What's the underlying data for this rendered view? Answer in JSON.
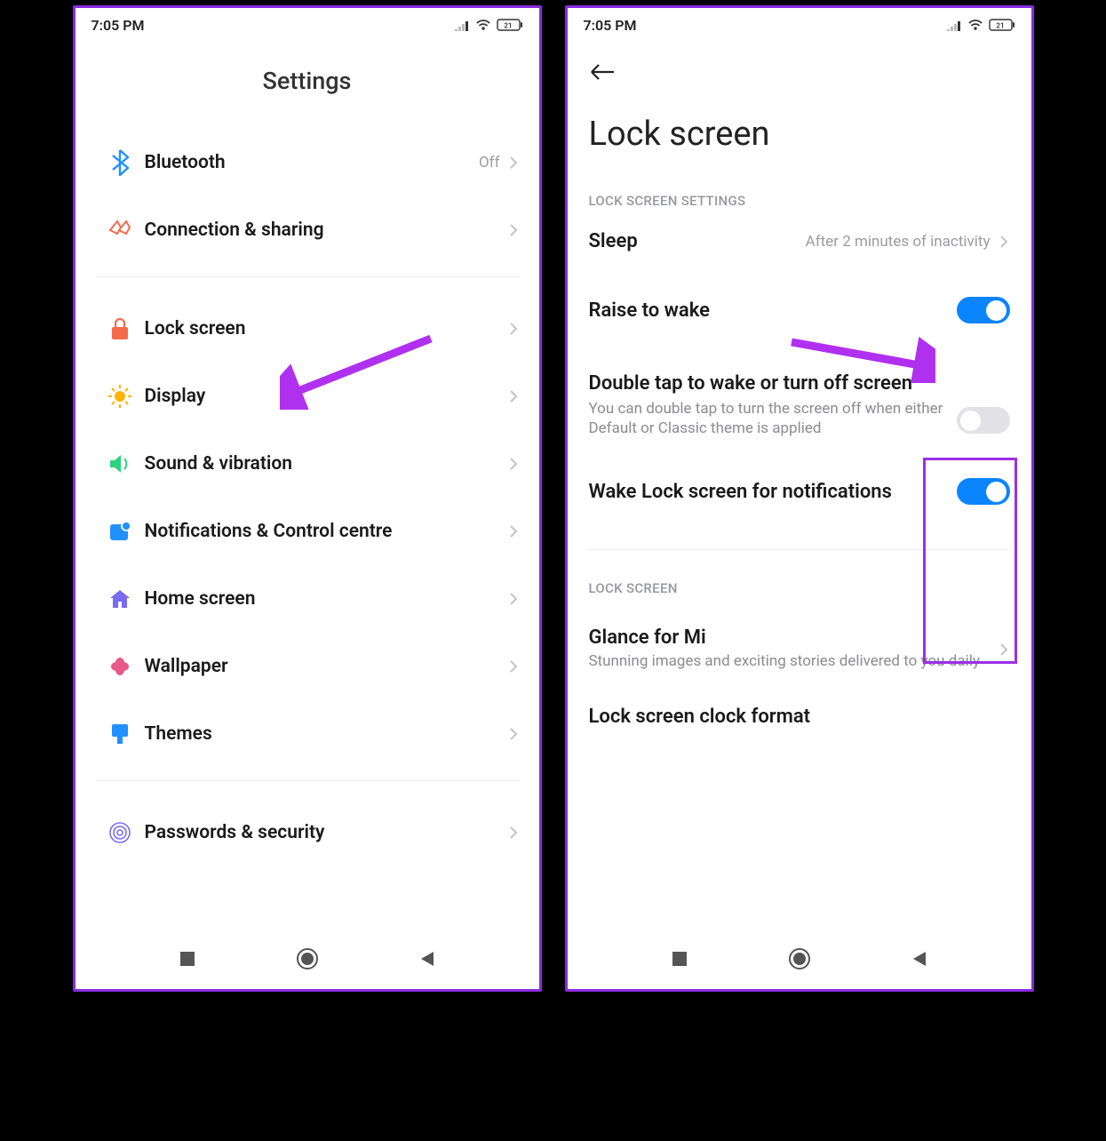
{
  "status": {
    "time": "7:05 PM",
    "battery": "21"
  },
  "left": {
    "title": "Settings",
    "items": [
      {
        "icon": "bluetooth",
        "label": "Bluetooth",
        "value": "Off"
      },
      {
        "icon": "connection",
        "label": "Connection & sharing"
      },
      {
        "_divider": true
      },
      {
        "icon": "lock",
        "label": "Lock screen"
      },
      {
        "icon": "sun",
        "label": "Display"
      },
      {
        "icon": "sound",
        "label": "Sound & vibration"
      },
      {
        "icon": "notif",
        "label": "Notifications & Control centre"
      },
      {
        "icon": "home",
        "label": "Home screen"
      },
      {
        "icon": "flower",
        "label": "Wallpaper"
      },
      {
        "icon": "themes",
        "label": "Themes"
      },
      {
        "_divider": true
      },
      {
        "icon": "finger",
        "label": "Passwords & security"
      }
    ]
  },
  "right": {
    "title": "Lock screen",
    "section1": "LOCK SCREEN SETTINGS",
    "sleep": {
      "label": "Sleep",
      "value": "After 2 minutes of inactivity"
    },
    "raise": {
      "label": "Raise to wake",
      "on": true
    },
    "double": {
      "label": "Double tap to wake or turn off screen",
      "sub": "You can double tap to turn the screen off when either Default or Classic theme is applied",
      "on": false
    },
    "wake": {
      "label": "Wake Lock screen for notifications",
      "on": true
    },
    "section2": "LOCK SCREEN",
    "glance": {
      "label": "Glance for Mi",
      "sub": "Stunning images and exciting stories delivered to you daily"
    },
    "clockfmt": {
      "label": "Lock screen clock format"
    }
  }
}
